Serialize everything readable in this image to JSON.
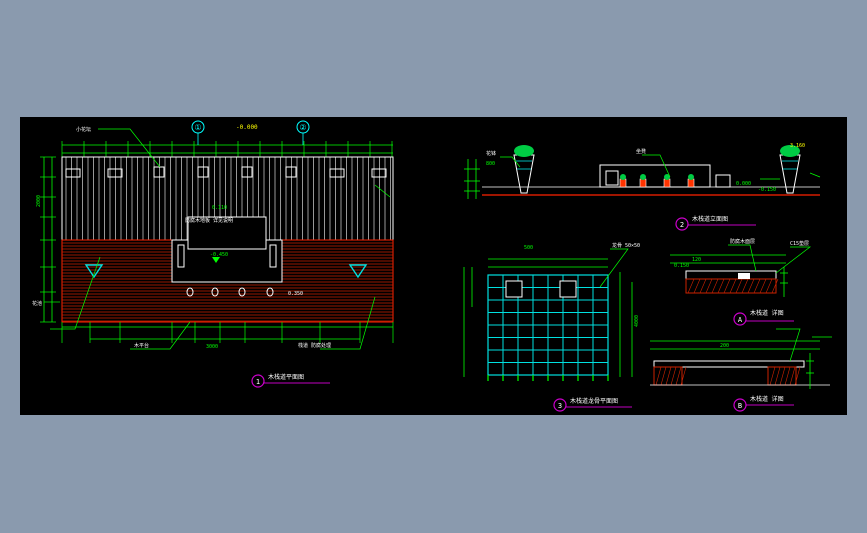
{
  "colors": {
    "background": "#8a9aae",
    "sheet": "#000000",
    "dimension": "#00ff00",
    "structure": "#ffffff",
    "deck": "#cc2200",
    "grid": "#00e0e0",
    "annotation": "#ffff00",
    "title_bubble": "#cc00cc",
    "title_underline": "#ff00ff",
    "pot": "#ff3300",
    "plant": "#00cc44"
  },
  "markers": {
    "plan": "1",
    "elevation": "2",
    "framing": "3",
    "detail_a": "A",
    "detail_b": "B",
    "north_1": "①",
    "north_2": "②"
  },
  "titles": {
    "plan": "木栈道平面图",
    "elevation": "木栈道立面图",
    "framing": "木栈道龙骨平面图",
    "detail_a": "木栈道 详图",
    "detail_b": "木栈道 详图"
  },
  "plan_labels": {
    "level_top": "-0.000",
    "level_mid": "0.110",
    "level_low": "-0.450",
    "level_right": "0.350",
    "note_center": "防腐木地板 详见说明",
    "note_left_top": "小花坛",
    "note_left_bottom": "花池",
    "note_bottom": "木平台",
    "note_bottom_right": "栈道 防腐处理",
    "dim_small": "75",
    "dim_mid": "120",
    "dim_long": "2000",
    "dim_top_a": "1000",
    "dim_top_b": "750",
    "dim_bottom_a": "750",
    "dim_bottom_b": "1150",
    "dim_bottom_c": "3000"
  },
  "elevation_labels": {
    "height_top": "3.160",
    "height_mid": "0.000",
    "height_low": "-0.150",
    "note_pot": "花钵",
    "note_bench": "坐凳",
    "dim_height": "800"
  },
  "framing_labels": {
    "dim_cell": "500",
    "dim_total": "4000",
    "note": "龙骨 50×50"
  },
  "detail_labels": {
    "dim_a": "120",
    "dim_b": "200",
    "note_a": "防腐木面层",
    "note_b": "C15垫层",
    "level": "0.150"
  }
}
